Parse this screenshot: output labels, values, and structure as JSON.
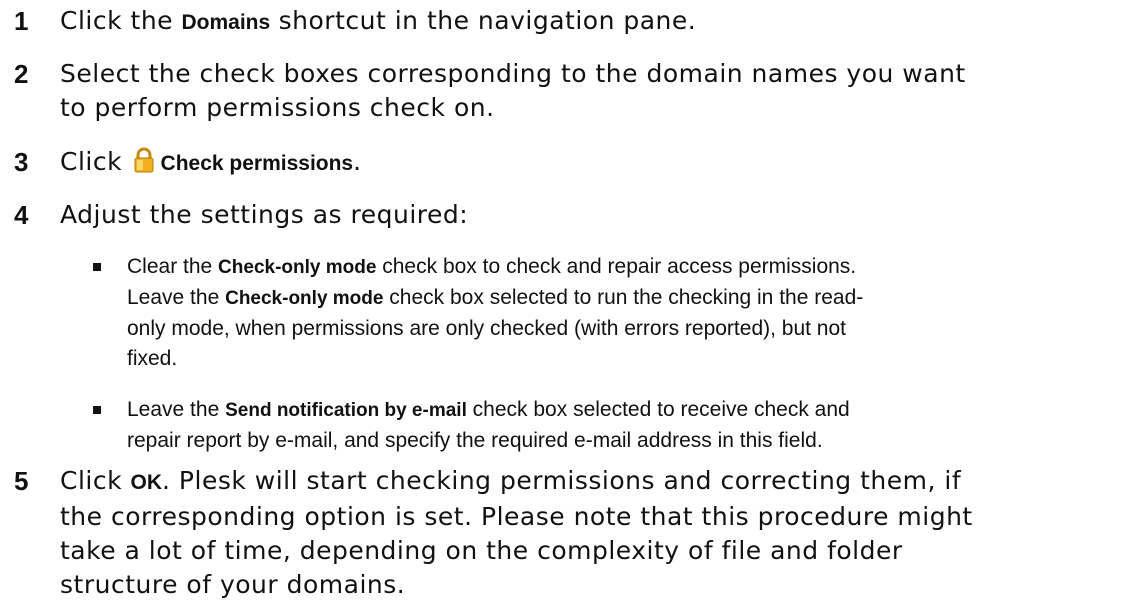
{
  "steps": [
    {
      "num": "1",
      "a": "Click the ",
      "b": "Domains",
      "c": " shortcut in the navigation pane."
    },
    {
      "num": "2",
      "line1": "Select the check boxes corresponding to the domain names you want",
      "line2": "to perform permissions check on."
    },
    {
      "num": "3",
      "a": "Click ",
      "icon": "lock-icon",
      "b": "Check permissions",
      "c": "."
    },
    {
      "num": "4",
      "text": "Adjust the settings as required:"
    },
    {
      "num": "5",
      "a": "Click ",
      "b": "OK",
      "c": ". Plesk will start checking permissions and correcting them, if",
      "line2": "the corresponding option is set. Please note that this procedure might",
      "line3": "take a lot of time, depending on the complexity of file and folder",
      "line4": "structure of your domains."
    }
  ],
  "bullets": [
    {
      "l1a": "Clear the ",
      "l1b": "Check-only mode",
      "l1c": " check box to check and repair access permissions.",
      "l2a": "Leave the ",
      "l2b": "Check-only mode",
      "l2c": " check box selected to run the checking in the read-",
      "l3": "only mode, when permissions are only checked (with errors reported), but not",
      "l4": "fixed."
    },
    {
      "l1a": "Leave the ",
      "l1b": "Send notification by e-mail",
      "l1c": " check box selected to receive check and",
      "l2": "repair report by e-mail, and specify the required e-mail address in this field."
    }
  ],
  "colors": {
    "text": "#111111",
    "lock_body": "#f2b01e",
    "lock_shackle": "#c98a0c"
  }
}
